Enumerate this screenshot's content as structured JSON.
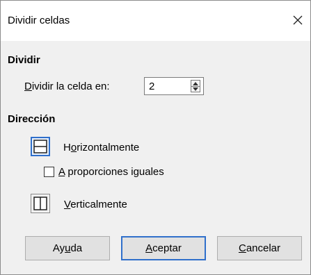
{
  "window": {
    "title": "Dividir celdas"
  },
  "split_section": {
    "title": "Dividir",
    "split_label_first": "D",
    "split_label_rest": "ividir la celda en:",
    "split_value": "2"
  },
  "direction_section": {
    "title": "Dirección",
    "horizontal_first": "H",
    "horizontal_u": "o",
    "horizontal_rest": "rizontalmente",
    "equal_u": "A",
    "equal_rest": " proporciones iguales",
    "equal_checked": false,
    "vertical_u": "V",
    "vertical_rest": "erticalmente",
    "selected": "horizontal"
  },
  "buttons": {
    "help_a": "Ay",
    "help_u": "u",
    "help_b": "da",
    "ok_u": "A",
    "ok_rest": "ceptar",
    "cancel_u": "C",
    "cancel_rest": "ancelar"
  },
  "icons": {
    "close": "close-icon",
    "spin_up": "chevron-up-icon",
    "spin_down": "chevron-down-icon",
    "horizontal": "split-horizontal-icon",
    "vertical": "split-vertical-icon"
  },
  "colors": {
    "accent": "#2f6fcb",
    "dialog_bg": "#f0f0f0",
    "button_bg": "#e1e1e1"
  }
}
